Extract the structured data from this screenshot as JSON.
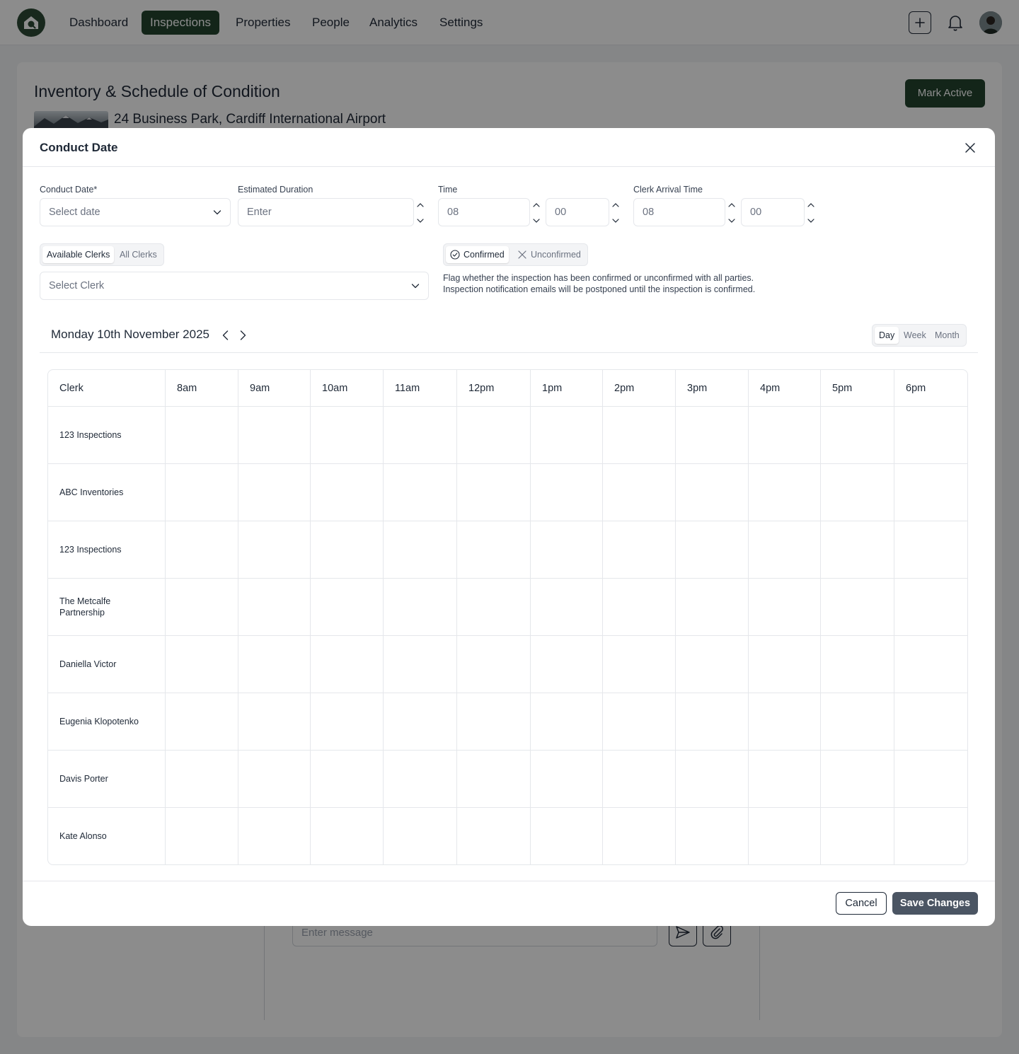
{
  "nav": {
    "items": [
      {
        "label": "Dashboard",
        "active": false
      },
      {
        "label": "Inspections",
        "active": true
      },
      {
        "label": "Properties",
        "active": false
      },
      {
        "label": "People",
        "active": false
      },
      {
        "label": "Analytics",
        "active": false
      },
      {
        "label": "Settings",
        "active": false
      }
    ]
  },
  "page": {
    "title": "Inventory & Schedule of Condition",
    "address": "24 Business Park, Cardiff International Airport",
    "mark_active_label": "Mark Active",
    "message_placeholder": "Enter message"
  },
  "modal": {
    "title": "Conduct Date",
    "conduct_date": {
      "label": "Conduct Date*",
      "placeholder": "Select date"
    },
    "estimated_duration": {
      "label": "Estimated Duration",
      "placeholder": "Enter"
    },
    "time": {
      "label": "Time",
      "hours": "08",
      "minutes": "00"
    },
    "clerk_arrival_time": {
      "label": "Clerk Arrival Time",
      "hours": "08",
      "minutes": "00"
    },
    "clerk_filter": {
      "options": [
        "Available Clerks",
        "All Clerks"
      ],
      "selected": "Available Clerks"
    },
    "clerk_select": {
      "placeholder": "Select Clerk"
    },
    "confirmation": {
      "options": [
        "Confirmed",
        "Unconfirmed"
      ],
      "selected": "Confirmed"
    },
    "help_text": {
      "line1": "Flag whether the inspection has been confirmed or unconfirmed with all parties.",
      "line2": "Inspection notification emails will be postponed until the inspection is confirmed."
    },
    "calendar": {
      "date": "Monday 10th November 2025",
      "views": [
        "Day",
        "Week",
        "Month"
      ],
      "selected_view": "Day"
    },
    "schedule": {
      "first_column": "Clerk",
      "hours": [
        "8am",
        "9am",
        "10am",
        "11am",
        "12pm",
        "1pm",
        "2pm",
        "3pm",
        "4pm",
        "5pm",
        "6pm"
      ],
      "clerks": [
        "123 Inspections",
        "ABC Inventories",
        "123 Inspections",
        "The Metcalfe Partnership",
        "Daniella Victor",
        "Eugenia Klopotenko",
        "Davis Porter",
        "Kate Alonso"
      ]
    },
    "cancel_label": "Cancel",
    "save_label": "Save Changes"
  }
}
